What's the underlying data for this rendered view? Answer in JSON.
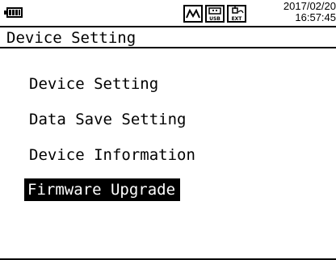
{
  "status": {
    "battery_icon": "battery-icon",
    "icons": [
      "waveform-icon",
      "usb-icon",
      "ext-icon"
    ],
    "date": "2017/02/20",
    "time": "16:57:45"
  },
  "title": "Device Setting",
  "menu": {
    "items": [
      {
        "label": "Device Setting",
        "selected": false
      },
      {
        "label": "Data Save Setting",
        "selected": false
      },
      {
        "label": "Device Information",
        "selected": false
      },
      {
        "label": "Firmware Upgrade",
        "selected": true
      }
    ]
  }
}
